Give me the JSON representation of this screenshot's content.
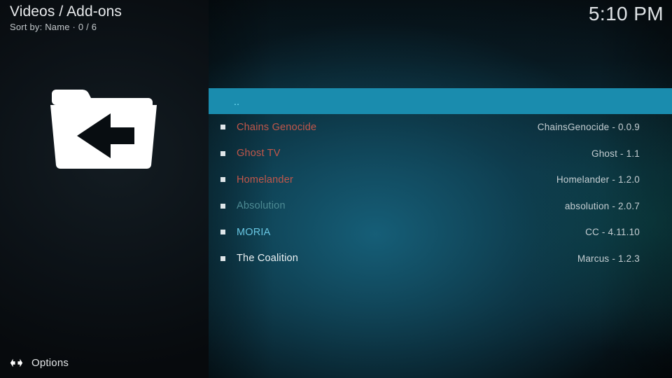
{
  "left": {
    "page_title": "Videos / Add-ons",
    "sort_info": "Sort by: Name  ·  0 / 6",
    "folder_icon": "folder-up-icon",
    "options_icon": "options-arrows-icon",
    "options_label": "Options"
  },
  "right": {
    "clock": "5:10 PM",
    "items": [
      {
        "label": "..",
        "version": "",
        "selected": true,
        "color": "#7fe8ff",
        "bullet": false
      },
      {
        "label": "Chains Genocide",
        "version": "ChainsGenocide - 0.0.9",
        "selected": false,
        "color": "#c2574a",
        "bullet": true
      },
      {
        "label": "Ghost TV",
        "version": "Ghost - 1.1",
        "selected": false,
        "color": "#c2574a",
        "bullet": true
      },
      {
        "label": "Homelander",
        "version": "Homelander - 1.2.0",
        "selected": false,
        "color": "#c2574a",
        "bullet": true
      },
      {
        "label": "Absolution",
        "version": "absolution - 2.0.7",
        "selected": false,
        "color": "#4d8a93",
        "bullet": true
      },
      {
        "label": "MORIA",
        "version": "CC - 4.11.10",
        "selected": false,
        "color": "#68c6e2",
        "bullet": true
      },
      {
        "label": "The Coalition",
        "version": "Marcus - 1.2.3",
        "selected": false,
        "color": "#eef3f5",
        "bullet": true
      }
    ]
  },
  "colors": {
    "highlight": "#1a8cae",
    "panel_dark": "#0b1116",
    "accent_teal": "#0e3848",
    "text_primary": "#e8eaec",
    "text_secondary": "#c5ced2"
  }
}
